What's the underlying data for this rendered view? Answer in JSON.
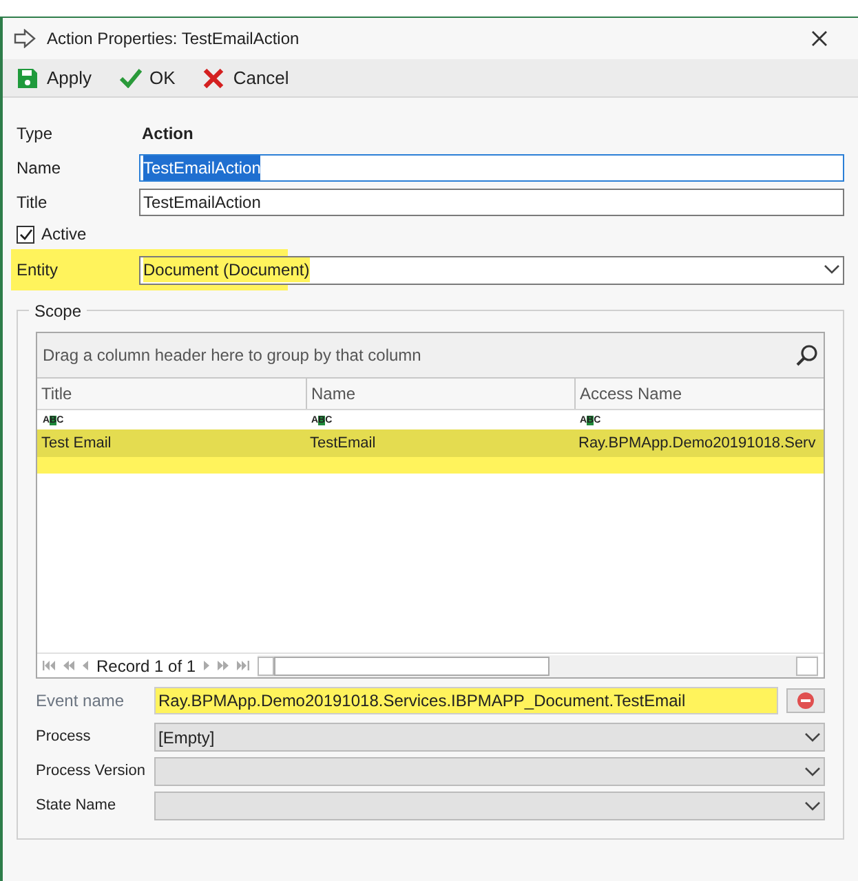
{
  "window": {
    "title": "Action Properties: TestEmailAction"
  },
  "toolbar": [
    {
      "kind": "save",
      "label": "Apply"
    },
    {
      "kind": "ok",
      "label": "OK"
    },
    {
      "kind": "cancel",
      "label": "Cancel"
    }
  ],
  "type": {
    "label": "Type",
    "value": "Action"
  },
  "name": {
    "label": "Name",
    "value": "TestEmailAction",
    "focused": true
  },
  "title": {
    "label": "Title",
    "value": "TestEmailAction",
    "focused": false
  },
  "active": {
    "label": "Active",
    "checked": true
  },
  "entity": {
    "label": "Entity",
    "value": "Document (Document)",
    "highlighted": true
  },
  "scope": {
    "title": "Scope",
    "grid": {
      "group_panel": "Drag a column header here to group by that column",
      "columns": [
        "Title",
        "Name",
        "Access Name"
      ],
      "filter_row": [
        "ABC",
        "ABC",
        "ABC"
      ],
      "rows": [
        {
          "cells": [
            "Test Email",
            "TestEmail",
            "Ray.BPMApp.Demo20191018.Serv"
          ],
          "selected": true,
          "highlighted": true
        }
      ],
      "navigator": "Record 1 of 1"
    },
    "event_name": {
      "label": "Event name",
      "value": "Ray.BPMApp.Demo20191018.Services.IBPMAPP_Document.TestEmail",
      "highlighted": true
    },
    "dropdowns": [
      {
        "label": "Process",
        "value": "[Empty]"
      },
      {
        "label": "Process Version"
      },
      {
        "label": "State Name"
      }
    ]
  }
}
